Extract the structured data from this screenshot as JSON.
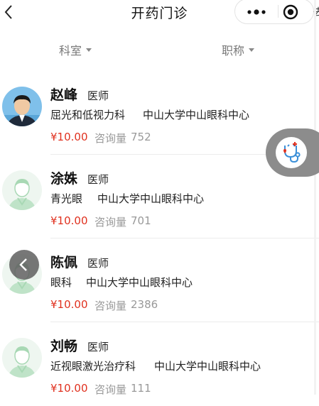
{
  "header": {
    "title": "开药门诊",
    "edge_char": "去"
  },
  "filters": {
    "department": "科室",
    "title": "职称"
  },
  "doctors": [
    {
      "name": "赵峰",
      "title": "医师",
      "department": "屈光和低视力科",
      "hospital": "中山大学中山眼科中心",
      "price": "¥10.00",
      "consult_label": "咨询量",
      "consult_count": "752",
      "avatar": "photo"
    },
    {
      "name": "涂姝",
      "title": "医师",
      "department": "青光眼",
      "hospital": "中山大学中山眼科中心",
      "price": "¥10.00",
      "consult_label": "咨询量",
      "consult_count": "701",
      "avatar": "placeholder"
    },
    {
      "name": "陈佩",
      "title": "医师",
      "department": "眼科",
      "hospital": "中山大学中山眼科中心",
      "price": "¥10.00",
      "consult_label": "咨询量",
      "consult_count": "2386",
      "avatar": "placeholder"
    },
    {
      "name": "刘畅",
      "title": "医师",
      "department": "近视眼激光治疗科",
      "hospital": "中山大学中山眼科中心",
      "price": "¥10.00",
      "consult_label": "咨询量",
      "consult_count": "111",
      "avatar": "placeholder"
    }
  ],
  "colors": {
    "price": "#e0311f",
    "muted": "#999999",
    "avatar_placeholder": "#a8d8b4"
  },
  "icons": {
    "back": "chevron-left-icon",
    "more": "more-dots-icon",
    "close": "target-close-icon",
    "float": "stethoscope-icon",
    "back_float": "chevron-left-icon"
  }
}
